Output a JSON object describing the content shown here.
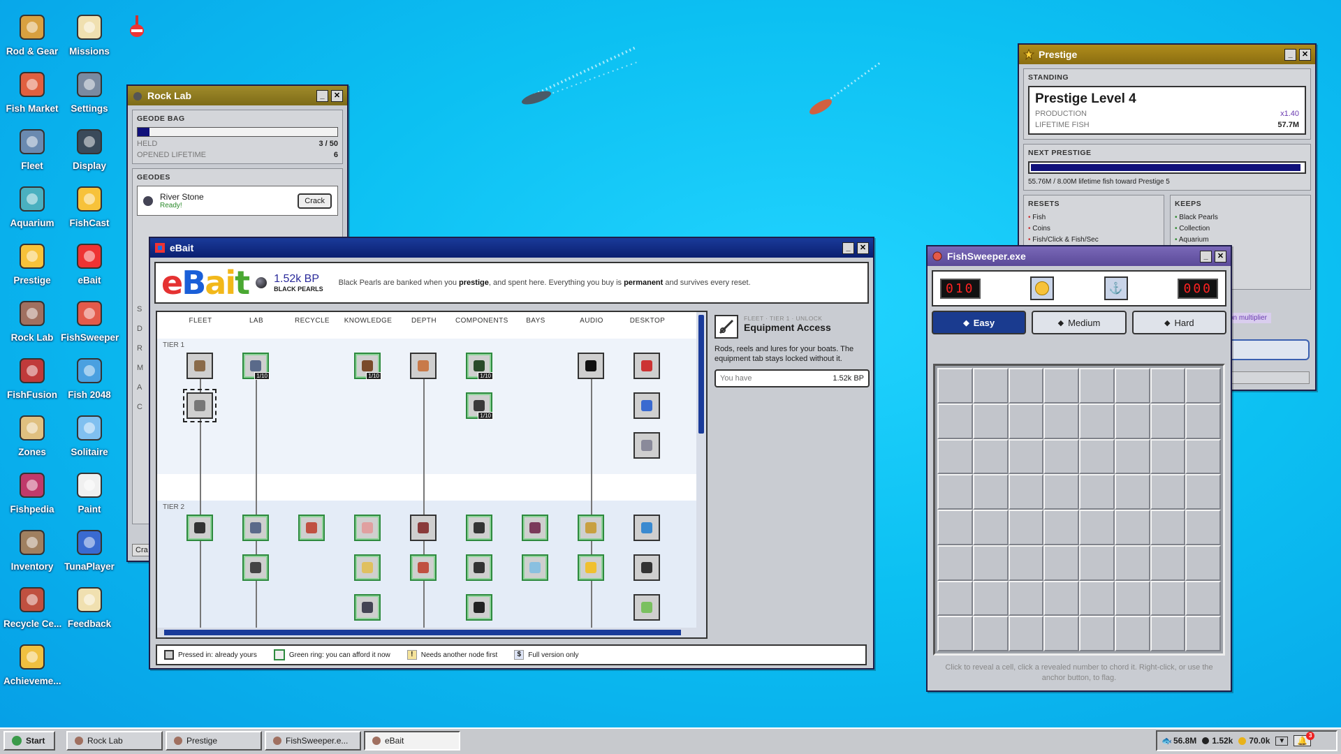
{
  "desktop_icons": [
    {
      "label": "Rod & Gear",
      "icon": "fishing-rod-icon"
    },
    {
      "label": "Missions",
      "icon": "clipboard-icon"
    },
    {
      "label": "Fish Market",
      "icon": "market-stall-icon"
    },
    {
      "label": "Settings",
      "icon": "ship-wheel-icon"
    },
    {
      "label": "Fleet",
      "icon": "boat-icon"
    },
    {
      "label": "Display",
      "icon": "monitor-icon"
    },
    {
      "label": "Aquarium",
      "icon": "fishbowl-icon"
    },
    {
      "label": "FishCast",
      "icon": "star-burst-icon"
    },
    {
      "label": "Prestige",
      "icon": "star-icon"
    },
    {
      "label": "eBait",
      "icon": "ebait-logo-icon"
    },
    {
      "label": "Rock Lab",
      "icon": "rock-icon"
    },
    {
      "label": "FishSweeper",
      "icon": "sea-urchin-icon"
    },
    {
      "label": "FishFusion",
      "icon": "gift-box-icon"
    },
    {
      "label": "Fish 2048",
      "icon": "fish-icon"
    },
    {
      "label": "Zones",
      "icon": "island-icon"
    },
    {
      "label": "Solitaire",
      "icon": "playing-card-icon"
    },
    {
      "label": "Fishpedia",
      "icon": "book-icon"
    },
    {
      "label": "Paint",
      "icon": "paint-icon"
    },
    {
      "label": "Inventory",
      "icon": "crate-icon"
    },
    {
      "label": "TunaPlayer",
      "icon": "media-player-icon"
    },
    {
      "label": "Recycle Ce...",
      "icon": "recycle-bin-icon"
    },
    {
      "label": "Feedback",
      "icon": "notepad-icon"
    },
    {
      "label": "Achieveme...",
      "icon": "trophy-icon"
    }
  ],
  "rocklab": {
    "title": "Rock Lab",
    "bag_header": "GEODE BAG",
    "bag_fill": 0.06,
    "held_label": "HELD",
    "held_value": "3 / 50",
    "opened_label": "OPENED LIFETIME",
    "opened_value": "6",
    "geodes_header": "GEODES",
    "geode_name": "River Stone",
    "geode_status": "Ready!",
    "crack_label": "Crack",
    "side_letters": [
      "S",
      "D",
      "R",
      "M",
      "A",
      "C"
    ],
    "footer_label": "Cra"
  },
  "prestige": {
    "title": "Prestige",
    "standing_header": "STANDING",
    "level": "Prestige Level 4",
    "production_label": "PRODUCTION",
    "production_value": "x1.40",
    "lifetime_label": "LIFETIME FISH",
    "lifetime_value": "57.7M",
    "next_header": "NEXT PRESTIGE",
    "next_fill": 0.99,
    "next_text": "55.76M / 8.00M lifetime fish toward Prestige 5",
    "resets_header": "RESETS",
    "resets": [
      "Fish",
      "Coins",
      "Fish/Click & Fish/Sec"
    ],
    "keeps_header": "KEEPS",
    "keeps": [
      "Black Pearls",
      "Collection",
      "Aquarium"
    ],
    "badge": "on multiplier"
  },
  "ebait": {
    "title": "eBait",
    "logo": "eBait",
    "bp_value": "1.52k BP",
    "bp_label": "BLACK PEARLS",
    "desc_1": "Black Pearls are banked when you ",
    "desc_b1": "prestige",
    "desc_2": ", and spent here. Everything you buy is ",
    "desc_b2": "permanent",
    "desc_3": " and survives every reset.",
    "columns": [
      "FLEET",
      "LAB",
      "RECYCLE",
      "KNOWLEDGE",
      "DEPTH",
      "COMPONENTS",
      "BAYS",
      "AUDIO",
      "DESKTOP"
    ],
    "tier1": "TIER 1",
    "tier2": "TIER 2",
    "count_label": "1/10",
    "detail": {
      "crumb": "FLEET · TIER 1 · UNLOCK",
      "title": "Equipment Access",
      "desc": "Rods, reels and lures for your boats. The equipment tab stays locked without it.",
      "have_label": "You have",
      "have_value": "1.52k BP"
    },
    "legend": {
      "pressed": "Pressed in: already yours",
      "green": "Green ring: you can afford it now",
      "needs": "Needs another node first",
      "full": "Full version only",
      "needs_glyph": "!",
      "full_glyph": "$"
    }
  },
  "sweeper": {
    "title": "FishSweeper.exe",
    "mines": "010",
    "timer": "000",
    "diff": [
      "Easy",
      "Medium",
      "Hard"
    ],
    "selected": "Easy",
    "grid_size": 8,
    "hint": "Click to reveal a cell, click a revealed number to chord it. Right-click, or use the anchor button, to flag."
  },
  "taskbar": {
    "start": "Start",
    "tasks": [
      "Rock Lab",
      "Prestige",
      "FishSweeper.e...",
      "eBait"
    ],
    "fish": "56.8M",
    "pearls": "1.52k",
    "coins": "70.0k",
    "notif": "3"
  },
  "colors": {
    "ebait_title": "#0b2a86",
    "rocklab_title": "#8b7a20",
    "prestige_title": "#9a7b14",
    "sweeper_title": "#6b5aa6",
    "accent": "#1a3b8f"
  }
}
